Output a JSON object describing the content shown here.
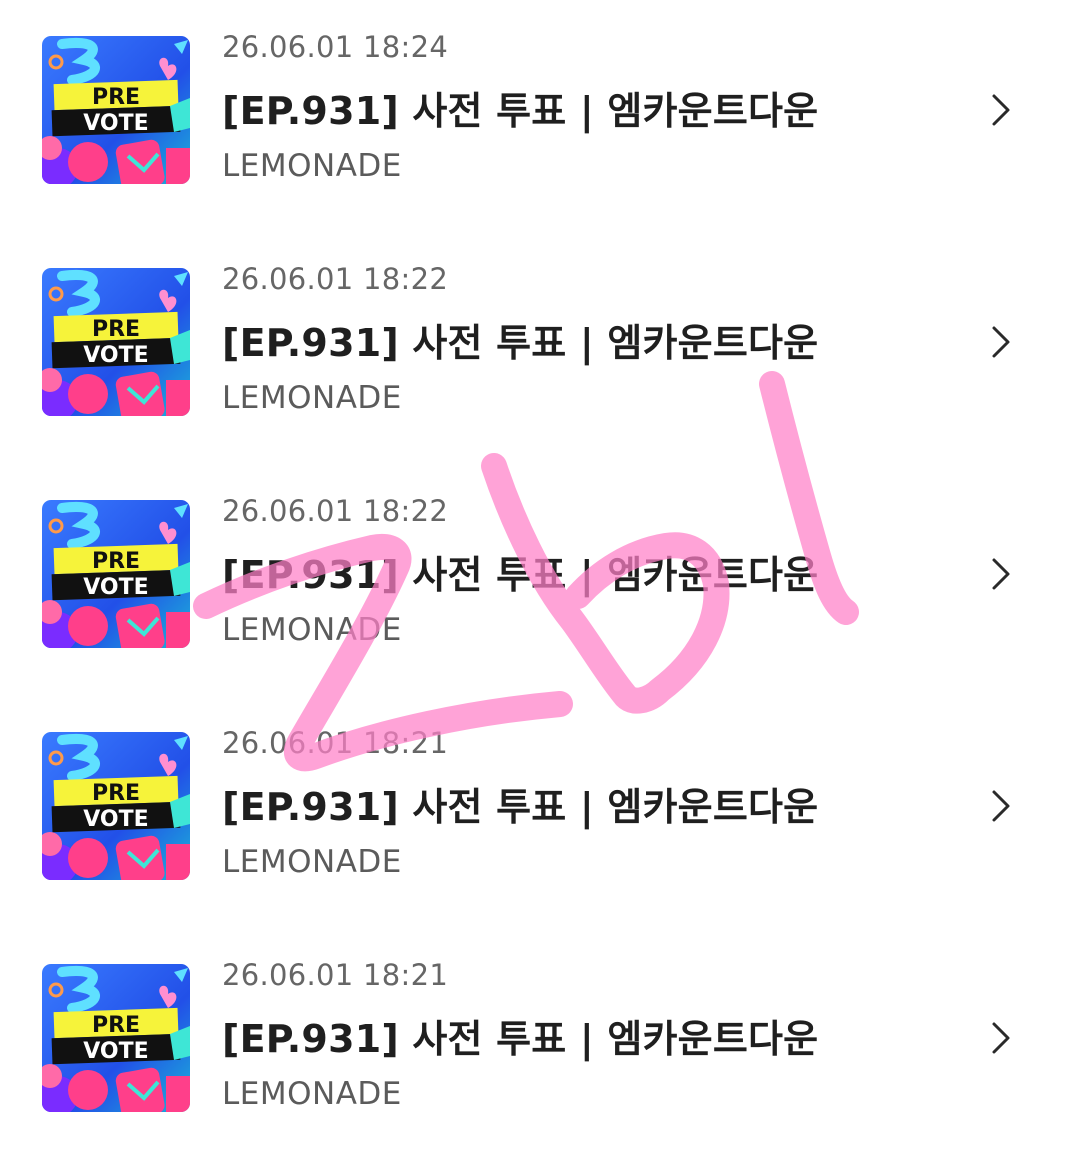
{
  "items": [
    {
      "date": "26.06.01 18:24",
      "title": "[EP.931] 사전 투표 | 엠카운트다운",
      "channel": "LEMONADE",
      "thumb_text_1": "PRE",
      "thumb_text_2": "VOTE"
    },
    {
      "date": "26.06.01 18:22",
      "title": "[EP.931] 사전 투표 | 엠카운트다운",
      "channel": "LEMONADE",
      "thumb_text_1": "PRE",
      "thumb_text_2": "VOTE"
    },
    {
      "date": "26.06.01 18:22",
      "title": "[EP.931] 사전 투표 | 엠카운트다운",
      "channel": "LEMONADE",
      "thumb_text_1": "PRE",
      "thumb_text_2": "VOTE"
    },
    {
      "date": "26.06.01 18:21",
      "title": "[EP.931] 사전 투표 | 엠카운트다운",
      "channel": "LEMONADE",
      "thumb_text_1": "PRE",
      "thumb_text_2": "VOTE"
    },
    {
      "date": "26.06.01 18:21",
      "title": "[EP.931] 사전 투표 | 엠카운트다운",
      "channel": "LEMONADE",
      "thumb_text_1": "PRE",
      "thumb_text_2": "VOTE"
    }
  ],
  "icons": {
    "chevron": "chevron-right-icon",
    "thumbnail": "pre-vote-thumbnail"
  },
  "colors": {
    "background": "#ffffff",
    "title": "#1f1f1f",
    "date": "#666666",
    "channel": "#5b5b5b",
    "chevron": "#2a2a2a",
    "scribble": "#ff7fc8",
    "thumb_blue": "#2f6df0",
    "thumb_yellow": "#f6f33a",
    "thumb_pink": "#ff3f8a"
  }
}
